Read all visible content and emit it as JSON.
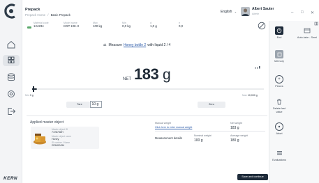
{
  "header": {
    "title": "Prepack",
    "breadcrumb": [
      "Prepack Home",
      "Basic Prepack"
    ],
    "breadcrumb_sep": "/",
    "language": "English",
    "user_name": "Albert Sauter",
    "user_role": "Admin",
    "window_controls": [
      "–",
      "□",
      "✕"
    ]
  },
  "info_row": [
    {
      "label": "Material code",
      "value": "124234"
    },
    {
      "label": "Model name",
      "value": "KDP 10K-3"
    },
    {
      "label": "Max",
      "value": "100 kg"
    },
    {
      "label": "Min",
      "value": "0,0 kg"
    },
    {
      "label": "d",
      "value": "1,0 g"
    },
    {
      "label": "e",
      "value": "0,0"
    }
  ],
  "instruction": {
    "prefix": "Measure",
    "link": "Honey bottle 2",
    "suffix": "with liquid 2 / 4"
  },
  "weight": {
    "prefix": "NET",
    "value": "183",
    "unit": "g"
  },
  "scale": {
    "min_label": "0 g",
    "max_prefix": "Max",
    "max_label": "10,000 g",
    "fill_fraction": 0.02
  },
  "tare": {
    "label": "Tare",
    "value": "10 g"
  },
  "zero": {
    "label": "Zero"
  },
  "master_object": {
    "heading": "Applied master object",
    "fields": [
      {
        "label": "Master object ID",
        "value": "7728738H"
      },
      {
        "label": "Master object name",
        "value": "Honey"
      },
      {
        "label": "ID number / Name",
        "value": "223402434"
      }
    ]
  },
  "results": {
    "manual_weight_label": "Manual weight",
    "manual_weight_link": "Click here to enter manual weight",
    "net_weight_label": "Net weight",
    "net_weight_value": "183 g",
    "measurement_details": "Measurement details",
    "nominal_label": "Nominal weight",
    "nominal_value": "100 g",
    "average_label": "Average weight",
    "average_value": "180 g"
  },
  "save_button": "Save and continue",
  "right_panel": {
    "end": "End",
    "autotake": "Auto-take - Semi",
    "memory": "Memory",
    "pieces": "Pieces",
    "delete_last": "Delete last value",
    "abort": "Abort",
    "evaluations": "Evaluations"
  },
  "brand": "KERN",
  "colors": {
    "accent": "#1e2b3a",
    "link": "#2b5aa8",
    "rail": "#f3f4f6"
  }
}
